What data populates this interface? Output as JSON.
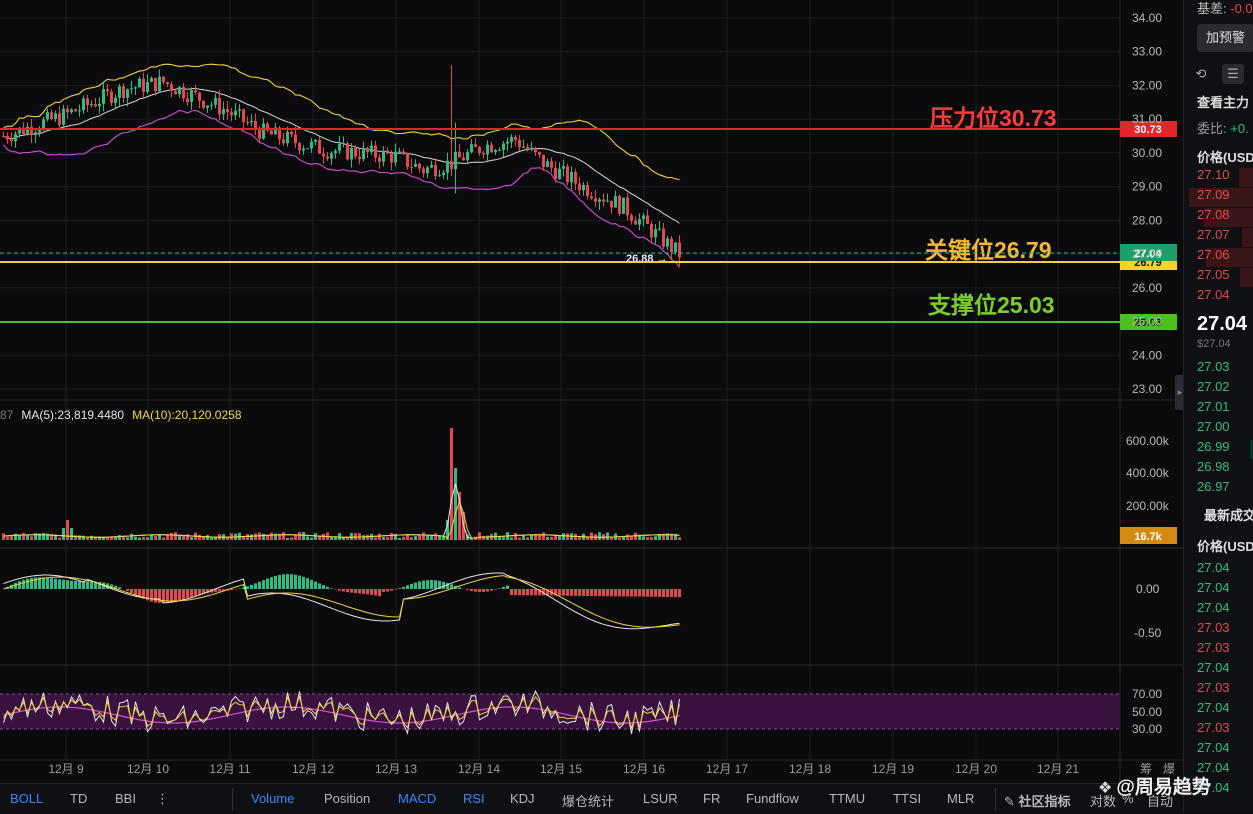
{
  "chart": {
    "price_axis": [
      "34.00",
      "33.00",
      "32.00",
      "31.00",
      "30.00",
      "29.00",
      "28.00",
      "27.00",
      "26.00",
      "25.00",
      "24.00",
      "23.00"
    ],
    "volume_axis": [
      "600.00k",
      "400.00k",
      "200.00k"
    ],
    "macd_axis": [
      "0.00",
      "-0.50"
    ],
    "rsi_axis": [
      "70.00",
      "50.00",
      "30.00"
    ],
    "dates": [
      "12月 9",
      "12月 10",
      "12月 11",
      "12月 12",
      "12月 13",
      "12月 14",
      "12月 15",
      "12月 16",
      "12月 17",
      "12月 18",
      "12月 19",
      "12月 20",
      "12月 21"
    ],
    "levels": {
      "resistance": {
        "label": "压力位30.73",
        "tag": "30.73",
        "color": "#e5252a",
        "text_color": "#ff3b3b"
      },
      "key": {
        "label": "关键位26.79",
        "tag": "26.79",
        "color": "#f2d230",
        "text_color": "#f5b92e"
      },
      "support": {
        "label": "支撑位25.03",
        "tag": "25.03",
        "color": "#4cc11a",
        "text_color": "#7ccf2a"
      }
    },
    "last_price_tag": "27.04",
    "low_marker": "26.88",
    "volume_tag": "16.7k",
    "ma_legend": {
      "prefix": "87",
      "ma5": "MA(5):23,819.4480",
      "ma10": "MA(10):20,120.0258"
    }
  },
  "orderbook": {
    "basis_label": "基差:",
    "basis_value": "-0.0",
    "alert_button": "加预警",
    "main_force": "查看主力",
    "ratio_label": "委比:",
    "ratio_value": "+0.",
    "price_header": "价格(USD",
    "asks": [
      "27.10",
      "27.09",
      "27.08",
      "27.07",
      "27.06",
      "27.05",
      "27.04"
    ],
    "last_price": "27.04",
    "last_price_usd": "$27.04",
    "bids": [
      "27.03",
      "27.02",
      "27.01",
      "27.00",
      "26.99",
      "26.98",
      "26.97"
    ],
    "trades_header": "最新成交",
    "trades_price_header": "价格(USD",
    "trades": [
      {
        "p": "27.04",
        "side": "buy"
      },
      {
        "p": "27.04",
        "side": "buy"
      },
      {
        "p": "27.04",
        "side": "buy"
      },
      {
        "p": "27.03",
        "side": "sell"
      },
      {
        "p": "27.03",
        "side": "sell"
      },
      {
        "p": "27.04",
        "side": "buy"
      },
      {
        "p": "27.03",
        "side": "sell"
      },
      {
        "p": "27.04",
        "side": "buy"
      },
      {
        "p": "27.03",
        "side": "sell"
      },
      {
        "p": "27.04",
        "side": "buy"
      },
      {
        "p": "27.04",
        "side": "buy"
      },
      {
        "p": "27.04",
        "side": "buy"
      }
    ]
  },
  "toolbar": {
    "items": [
      {
        "label": "BOLL",
        "active": true
      },
      {
        "label": "TD",
        "active": false
      },
      {
        "label": "BBI",
        "active": false
      },
      {
        "label": "Volume",
        "active": true
      },
      {
        "label": "Position",
        "active": false
      },
      {
        "label": "MACD",
        "active": true
      },
      {
        "label": "RSI",
        "active": true
      },
      {
        "label": "KDJ",
        "active": false
      },
      {
        "label": "爆仓统计",
        "active": false
      },
      {
        "label": "LSUR",
        "active": false
      },
      {
        "label": "FR",
        "active": false
      },
      {
        "label": "Fundflow",
        "active": false
      },
      {
        "label": "TTMU",
        "active": false
      },
      {
        "label": "TTSI",
        "active": false
      },
      {
        "label": "MLR",
        "active": false
      }
    ],
    "community": "社区指标",
    "right_items": [
      "对数",
      "%",
      "自动"
    ],
    "top_right": [
      "筹",
      "爆"
    ]
  },
  "watermark": "@周易趋势",
  "colors": {
    "up": "#2dbd85",
    "down": "#e5484d",
    "boll_upper": "#f2d230",
    "boll_mid": "#d8d8d8",
    "boll_lower": "#d44fd6"
  }
}
